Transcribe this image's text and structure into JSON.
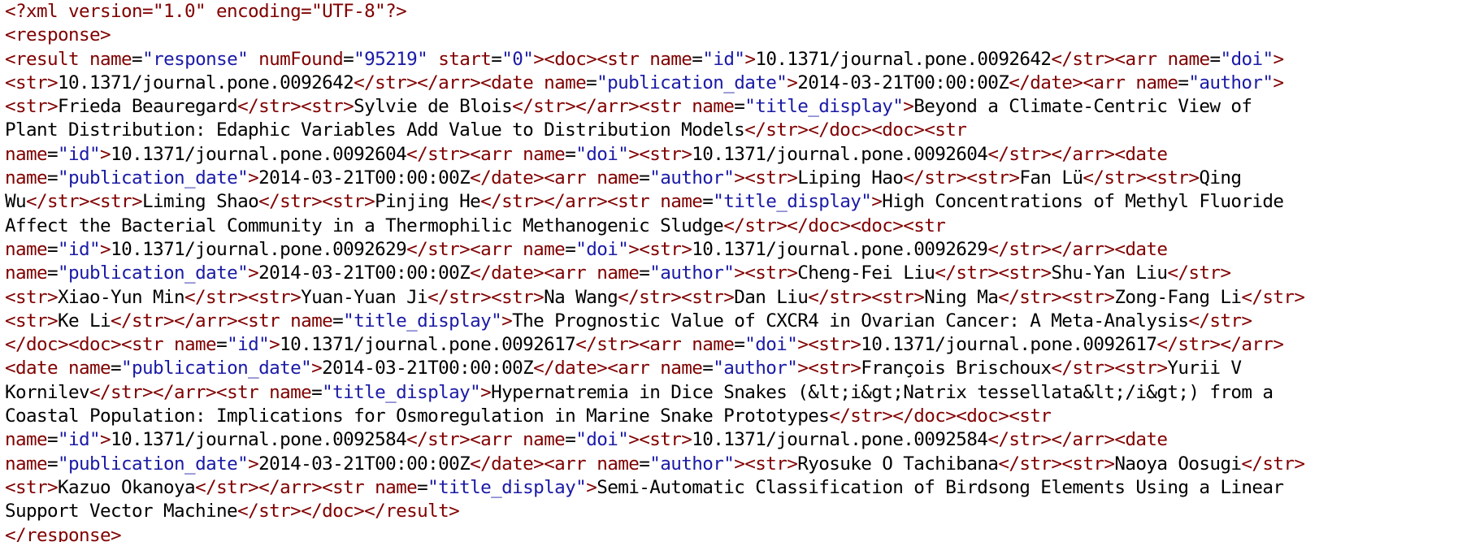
{
  "colors": {
    "text": "#000000",
    "tag": "#800000",
    "attribute_name": "#800000",
    "attribute_value": "#1a1aa6",
    "background": "#ffffff"
  },
  "lines": [
    [
      {
        "k": "t",
        "s": "<?xml version=\"1.0\" encoding=\"UTF-8\"?>"
      }
    ],
    [
      {
        "k": "t",
        "s": "<response>"
      }
    ],
    [
      {
        "k": "t",
        "s": "<result "
      },
      {
        "k": "a",
        "s": "name"
      },
      {
        "k": "c",
        "s": "="
      },
      {
        "k": "v",
        "s": "\"response\""
      },
      {
        "k": "c",
        "s": " "
      },
      {
        "k": "a",
        "s": "numFound"
      },
      {
        "k": "c",
        "s": "="
      },
      {
        "k": "v",
        "s": "\"95219\""
      },
      {
        "k": "c",
        "s": " "
      },
      {
        "k": "a",
        "s": "start"
      },
      {
        "k": "c",
        "s": "="
      },
      {
        "k": "v",
        "s": "\"0\""
      },
      {
        "k": "t",
        "s": "><doc><str "
      },
      {
        "k": "a",
        "s": "name"
      },
      {
        "k": "c",
        "s": "="
      },
      {
        "k": "v",
        "s": "\"id\""
      },
      {
        "k": "t",
        "s": ">"
      },
      {
        "k": "c",
        "s": "10.1371/journal.pone.0092642"
      },
      {
        "k": "t",
        "s": "</str><arr "
      },
      {
        "k": "a",
        "s": "name"
      },
      {
        "k": "c",
        "s": "="
      },
      {
        "k": "v",
        "s": "\"doi\""
      },
      {
        "k": "t",
        "s": ">"
      }
    ],
    [
      {
        "k": "t",
        "s": "<str>"
      },
      {
        "k": "c",
        "s": "10.1371/journal.pone.0092642"
      },
      {
        "k": "t",
        "s": "</str></arr><date "
      },
      {
        "k": "a",
        "s": "name"
      },
      {
        "k": "c",
        "s": "="
      },
      {
        "k": "v",
        "s": "\"publication_date\""
      },
      {
        "k": "t",
        "s": ">"
      },
      {
        "k": "c",
        "s": "2014-03-21T00:00:00Z"
      },
      {
        "k": "t",
        "s": "</date><arr "
      },
      {
        "k": "a",
        "s": "name"
      },
      {
        "k": "c",
        "s": "="
      },
      {
        "k": "v",
        "s": "\"author\""
      },
      {
        "k": "t",
        "s": ">"
      }
    ],
    [
      {
        "k": "t",
        "s": "<str>"
      },
      {
        "k": "c",
        "s": "Frieda Beauregard"
      },
      {
        "k": "t",
        "s": "</str><str>"
      },
      {
        "k": "c",
        "s": "Sylvie de Blois"
      },
      {
        "k": "t",
        "s": "</str></arr><str "
      },
      {
        "k": "a",
        "s": "name"
      },
      {
        "k": "c",
        "s": "="
      },
      {
        "k": "v",
        "s": "\"title_display\""
      },
      {
        "k": "t",
        "s": ">"
      },
      {
        "k": "c",
        "s": "Beyond a Climate-Centric View of"
      }
    ],
    [
      {
        "k": "c",
        "s": "Plant Distribution: Edaphic Variables Add Value to Distribution Models"
      },
      {
        "k": "t",
        "s": "</str></doc><doc><str"
      }
    ],
    [
      {
        "k": "a",
        "s": "name"
      },
      {
        "k": "c",
        "s": "="
      },
      {
        "k": "v",
        "s": "\"id\""
      },
      {
        "k": "t",
        "s": ">"
      },
      {
        "k": "c",
        "s": "10.1371/journal.pone.0092604"
      },
      {
        "k": "t",
        "s": "</str><arr "
      },
      {
        "k": "a",
        "s": "name"
      },
      {
        "k": "c",
        "s": "="
      },
      {
        "k": "v",
        "s": "\"doi\""
      },
      {
        "k": "t",
        "s": "><str>"
      },
      {
        "k": "c",
        "s": "10.1371/journal.pone.0092604"
      },
      {
        "k": "t",
        "s": "</str></arr><date"
      }
    ],
    [
      {
        "k": "a",
        "s": "name"
      },
      {
        "k": "c",
        "s": "="
      },
      {
        "k": "v",
        "s": "\"publication_date\""
      },
      {
        "k": "t",
        "s": ">"
      },
      {
        "k": "c",
        "s": "2014-03-21T00:00:00Z"
      },
      {
        "k": "t",
        "s": "</date><arr "
      },
      {
        "k": "a",
        "s": "name"
      },
      {
        "k": "c",
        "s": "="
      },
      {
        "k": "v",
        "s": "\"author\""
      },
      {
        "k": "t",
        "s": "><str>"
      },
      {
        "k": "c",
        "s": "Liping Hao"
      },
      {
        "k": "t",
        "s": "</str><str>"
      },
      {
        "k": "c",
        "s": "Fan Lü"
      },
      {
        "k": "t",
        "s": "</str><str>"
      },
      {
        "k": "c",
        "s": "Qing"
      }
    ],
    [
      {
        "k": "c",
        "s": "Wu"
      },
      {
        "k": "t",
        "s": "</str><str>"
      },
      {
        "k": "c",
        "s": "Liming Shao"
      },
      {
        "k": "t",
        "s": "</str><str>"
      },
      {
        "k": "c",
        "s": "Pinjing He"
      },
      {
        "k": "t",
        "s": "</str></arr><str "
      },
      {
        "k": "a",
        "s": "name"
      },
      {
        "k": "c",
        "s": "="
      },
      {
        "k": "v",
        "s": "\"title_display\""
      },
      {
        "k": "t",
        "s": ">"
      },
      {
        "k": "c",
        "s": "High Concentrations of Methyl Fluoride"
      }
    ],
    [
      {
        "k": "c",
        "s": "Affect the Bacterial Community in a Thermophilic Methanogenic Sludge"
      },
      {
        "k": "t",
        "s": "</str></doc><doc><str"
      }
    ],
    [
      {
        "k": "a",
        "s": "name"
      },
      {
        "k": "c",
        "s": "="
      },
      {
        "k": "v",
        "s": "\"id\""
      },
      {
        "k": "t",
        "s": ">"
      },
      {
        "k": "c",
        "s": "10.1371/journal.pone.0092629"
      },
      {
        "k": "t",
        "s": "</str><arr "
      },
      {
        "k": "a",
        "s": "name"
      },
      {
        "k": "c",
        "s": "="
      },
      {
        "k": "v",
        "s": "\"doi\""
      },
      {
        "k": "t",
        "s": "><str>"
      },
      {
        "k": "c",
        "s": "10.1371/journal.pone.0092629"
      },
      {
        "k": "t",
        "s": "</str></arr><date"
      }
    ],
    [
      {
        "k": "a",
        "s": "name"
      },
      {
        "k": "c",
        "s": "="
      },
      {
        "k": "v",
        "s": "\"publication_date\""
      },
      {
        "k": "t",
        "s": ">"
      },
      {
        "k": "c",
        "s": "2014-03-21T00:00:00Z"
      },
      {
        "k": "t",
        "s": "</date><arr "
      },
      {
        "k": "a",
        "s": "name"
      },
      {
        "k": "c",
        "s": "="
      },
      {
        "k": "v",
        "s": "\"author\""
      },
      {
        "k": "t",
        "s": "><str>"
      },
      {
        "k": "c",
        "s": "Cheng-Fei Liu"
      },
      {
        "k": "t",
        "s": "</str><str>"
      },
      {
        "k": "c",
        "s": "Shu-Yan Liu"
      },
      {
        "k": "t",
        "s": "</str>"
      }
    ],
    [
      {
        "k": "t",
        "s": "<str>"
      },
      {
        "k": "c",
        "s": "Xiao-Yun Min"
      },
      {
        "k": "t",
        "s": "</str><str>"
      },
      {
        "k": "c",
        "s": "Yuan-Yuan Ji"
      },
      {
        "k": "t",
        "s": "</str><str>"
      },
      {
        "k": "c",
        "s": "Na Wang"
      },
      {
        "k": "t",
        "s": "</str><str>"
      },
      {
        "k": "c",
        "s": "Dan Liu"
      },
      {
        "k": "t",
        "s": "</str><str>"
      },
      {
        "k": "c",
        "s": "Ning Ma"
      },
      {
        "k": "t",
        "s": "</str><str>"
      },
      {
        "k": "c",
        "s": "Zong-Fang Li"
      },
      {
        "k": "t",
        "s": "</str>"
      }
    ],
    [
      {
        "k": "t",
        "s": "<str>"
      },
      {
        "k": "c",
        "s": "Ke Li"
      },
      {
        "k": "t",
        "s": "</str></arr><str "
      },
      {
        "k": "a",
        "s": "name"
      },
      {
        "k": "c",
        "s": "="
      },
      {
        "k": "v",
        "s": "\"title_display\""
      },
      {
        "k": "t",
        "s": ">"
      },
      {
        "k": "c",
        "s": "The Prognostic Value of CXCR4 in Ovarian Cancer: A Meta-Analysis"
      },
      {
        "k": "t",
        "s": "</str>"
      }
    ],
    [
      {
        "k": "t",
        "s": "</doc><doc><str "
      },
      {
        "k": "a",
        "s": "name"
      },
      {
        "k": "c",
        "s": "="
      },
      {
        "k": "v",
        "s": "\"id\""
      },
      {
        "k": "t",
        "s": ">"
      },
      {
        "k": "c",
        "s": "10.1371/journal.pone.0092617"
      },
      {
        "k": "t",
        "s": "</str><arr "
      },
      {
        "k": "a",
        "s": "name"
      },
      {
        "k": "c",
        "s": "="
      },
      {
        "k": "v",
        "s": "\"doi\""
      },
      {
        "k": "t",
        "s": "><str>"
      },
      {
        "k": "c",
        "s": "10.1371/journal.pone.0092617"
      },
      {
        "k": "t",
        "s": "</str></arr>"
      }
    ],
    [
      {
        "k": "t",
        "s": "<date "
      },
      {
        "k": "a",
        "s": "name"
      },
      {
        "k": "c",
        "s": "="
      },
      {
        "k": "v",
        "s": "\"publication_date\""
      },
      {
        "k": "t",
        "s": ">"
      },
      {
        "k": "c",
        "s": "2014-03-21T00:00:00Z"
      },
      {
        "k": "t",
        "s": "</date><arr "
      },
      {
        "k": "a",
        "s": "name"
      },
      {
        "k": "c",
        "s": "="
      },
      {
        "k": "v",
        "s": "\"author\""
      },
      {
        "k": "t",
        "s": "><str>"
      },
      {
        "k": "c",
        "s": "François Brischoux"
      },
      {
        "k": "t",
        "s": "</str><str>"
      },
      {
        "k": "c",
        "s": "Yurii V"
      }
    ],
    [
      {
        "k": "c",
        "s": "Kornilev"
      },
      {
        "k": "t",
        "s": "</str></arr><str "
      },
      {
        "k": "a",
        "s": "name"
      },
      {
        "k": "c",
        "s": "="
      },
      {
        "k": "v",
        "s": "\"title_display\""
      },
      {
        "k": "t",
        "s": ">"
      },
      {
        "k": "c",
        "s": "Hypernatremia in Dice Snakes (&lt;i&gt;Natrix tessellata&lt;/i&gt;) from a"
      }
    ],
    [
      {
        "k": "c",
        "s": "Coastal Population: Implications for Osmoregulation in Marine Snake Prototypes"
      },
      {
        "k": "t",
        "s": "</str></doc><doc><str"
      }
    ],
    [
      {
        "k": "a",
        "s": "name"
      },
      {
        "k": "c",
        "s": "="
      },
      {
        "k": "v",
        "s": "\"id\""
      },
      {
        "k": "t",
        "s": ">"
      },
      {
        "k": "c",
        "s": "10.1371/journal.pone.0092584"
      },
      {
        "k": "t",
        "s": "</str><arr "
      },
      {
        "k": "a",
        "s": "name"
      },
      {
        "k": "c",
        "s": "="
      },
      {
        "k": "v",
        "s": "\"doi\""
      },
      {
        "k": "t",
        "s": "><str>"
      },
      {
        "k": "c",
        "s": "10.1371/journal.pone.0092584"
      },
      {
        "k": "t",
        "s": "</str></arr><date"
      }
    ],
    [
      {
        "k": "a",
        "s": "name"
      },
      {
        "k": "c",
        "s": "="
      },
      {
        "k": "v",
        "s": "\"publication_date\""
      },
      {
        "k": "t",
        "s": ">"
      },
      {
        "k": "c",
        "s": "2014-03-21T00:00:00Z"
      },
      {
        "k": "t",
        "s": "</date><arr "
      },
      {
        "k": "a",
        "s": "name"
      },
      {
        "k": "c",
        "s": "="
      },
      {
        "k": "v",
        "s": "\"author\""
      },
      {
        "k": "t",
        "s": "><str>"
      },
      {
        "k": "c",
        "s": "Ryosuke O Tachibana"
      },
      {
        "k": "t",
        "s": "</str><str>"
      },
      {
        "k": "c",
        "s": "Naoya Oosugi"
      },
      {
        "k": "t",
        "s": "</str>"
      }
    ],
    [
      {
        "k": "t",
        "s": "<str>"
      },
      {
        "k": "c",
        "s": "Kazuo Okanoya"
      },
      {
        "k": "t",
        "s": "</str></arr><str "
      },
      {
        "k": "a",
        "s": "name"
      },
      {
        "k": "c",
        "s": "="
      },
      {
        "k": "v",
        "s": "\"title_display\""
      },
      {
        "k": "t",
        "s": ">"
      },
      {
        "k": "c",
        "s": "Semi-Automatic Classification of Birdsong Elements Using a Linear"
      }
    ],
    [
      {
        "k": "c",
        "s": "Support Vector Machine"
      },
      {
        "k": "t",
        "s": "</str></doc></result>"
      }
    ],
    [
      {
        "k": "t",
        "s": "</response>"
      }
    ]
  ]
}
